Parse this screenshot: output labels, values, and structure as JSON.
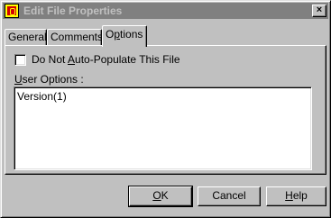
{
  "window": {
    "title": "Edit File Properties",
    "close_label": "×"
  },
  "tabs": [
    {
      "label": "General",
      "active": false
    },
    {
      "label": "Comments",
      "active": false
    },
    {
      "label": "Options",
      "active": true
    }
  ],
  "options": {
    "checkbox_label": "Do Not Auto-Populate This File",
    "checkbox_checked": false,
    "user_options_label": "User Options :",
    "user_options_value": "Version(1)"
  },
  "buttons": {
    "ok": "OK",
    "cancel": "Cancel",
    "help": "Help"
  },
  "colors": {
    "face": "#c0c0c0",
    "titlebar_inactive": "#808080",
    "title_text": "#c0c0c0",
    "field_bg": "#ffffff"
  },
  "icons": {
    "app_icon": "file-properties-app-icon",
    "close_icon": "close-icon"
  }
}
